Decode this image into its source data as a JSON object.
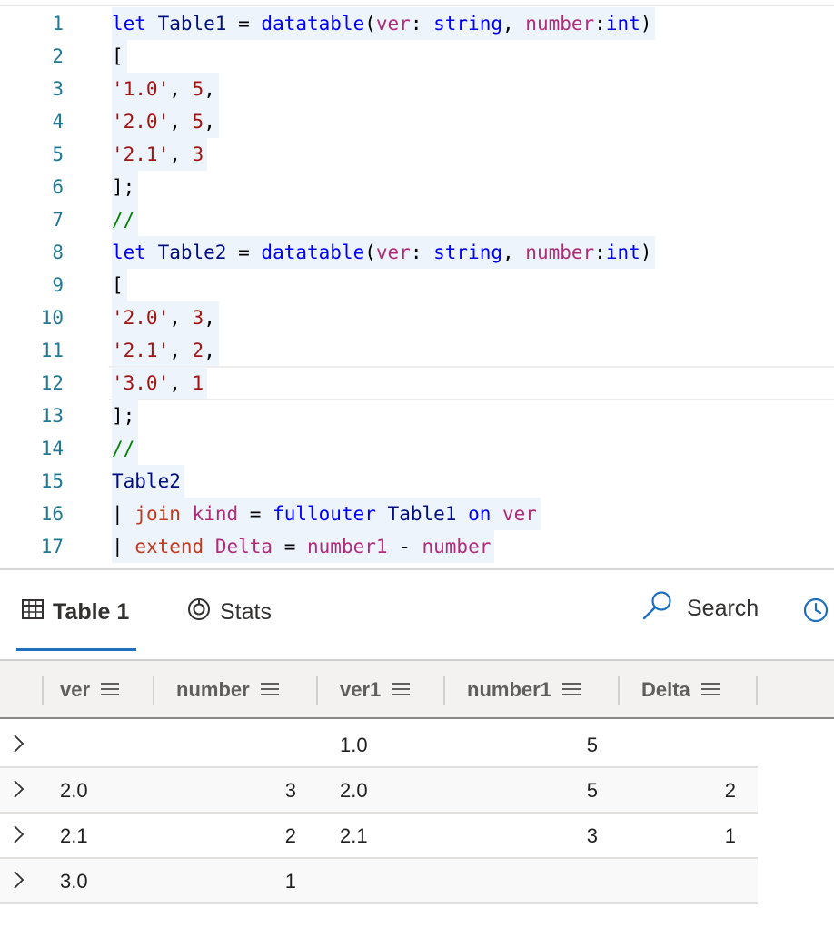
{
  "editor": {
    "lines": [
      {
        "n": "1"
      },
      {
        "n": "2"
      },
      {
        "n": "3"
      },
      {
        "n": "4"
      },
      {
        "n": "5"
      },
      {
        "n": "6"
      },
      {
        "n": "7"
      },
      {
        "n": "8"
      },
      {
        "n": "9"
      },
      {
        "n": "10"
      },
      {
        "n": "11"
      },
      {
        "n": "12"
      },
      {
        "n": "13"
      },
      {
        "n": "14"
      },
      {
        "n": "15"
      },
      {
        "n": "16"
      },
      {
        "n": "17"
      }
    ],
    "tok": {
      "let": "let",
      "table1": "Table1",
      "table2": "Table2",
      "eq": "=",
      "datatable": "datatable",
      "paren_open": "(",
      "ver": "ver",
      "colon": ":",
      "string": "string",
      "comma": ",",
      "number": "number",
      "int": "int",
      "paren_close": ")",
      "bracket_open": "[",
      "bracket_close_semi": "];",
      "comment": "//",
      "pipe": "|",
      "join": "join",
      "kind": "kind",
      "fullouter": "fullouter",
      "on": "on",
      "extend": "extend",
      "delta": "Delta",
      "number1": "number1",
      "minus": "-",
      "s10": "'1.0'",
      "s20": "'2.0'",
      "s21": "'2.1'",
      "s30": "'3.0'",
      "n1": "1",
      "n2": "2",
      "n3": "3",
      "n5": "5"
    }
  },
  "toolbar": {
    "tab_table": "Table 1",
    "tab_stats": "Stats",
    "search": "Search"
  },
  "grid": {
    "columns": [
      "ver",
      "number",
      "ver1",
      "number1",
      "Delta"
    ],
    "rows": [
      {
        "ver": "",
        "number": "",
        "ver1": "1.0",
        "number1": "5",
        "delta": ""
      },
      {
        "ver": "2.0",
        "number": "3",
        "ver1": "2.0",
        "number1": "5",
        "delta": "2"
      },
      {
        "ver": "2.1",
        "number": "2",
        "ver1": "2.1",
        "number1": "3",
        "delta": "1"
      },
      {
        "ver": "3.0",
        "number": "1",
        "ver1": "",
        "number1": "",
        "delta": ""
      }
    ]
  },
  "colors": {
    "accent": "#1e6fbf",
    "line_number": "#237893",
    "keyword": "#0000ff",
    "string": "#a31515",
    "column": "#b02c7a",
    "comment": "#008000"
  },
  "icons": {
    "table_tab": "table-grid-icon",
    "stats_tab": "stats-ring-icon",
    "search": "search-icon",
    "history": "clock-icon",
    "column_menu": "hamburger-menu-icon",
    "row_expand": "chevron-right-icon"
  }
}
